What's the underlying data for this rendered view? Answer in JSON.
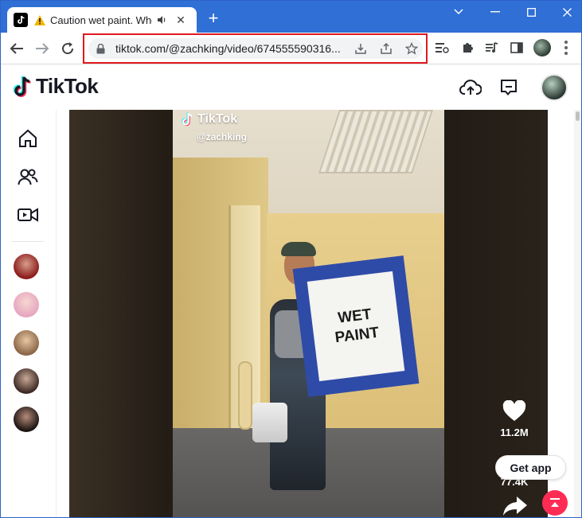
{
  "browser": {
    "tab": {
      "title": "Caution wet paint. Who w",
      "close_glyph": "✕"
    },
    "new_tab_glyph": "+",
    "address": {
      "url": "tiktok.com/@zachking/video/674555590316..."
    },
    "window_controls": {
      "minimize": "—",
      "maximize": "☐",
      "close": "✕",
      "chevron": "⌄"
    },
    "highlight_color": "#e0191f",
    "frame_color": "#2f6fd6"
  },
  "tiktok": {
    "logo_text": "TikTok",
    "accent_color": "#fe2c55",
    "sidebar": {
      "nav": [
        {
          "icon": "home-icon"
        },
        {
          "icon": "following-icon"
        },
        {
          "icon": "live-icon"
        }
      ],
      "accounts_count_shown": 5
    },
    "video": {
      "watermark_logo": "TikTok",
      "watermark_handle": "@zachking",
      "sign_line1": "WET",
      "sign_line2": "PAINT"
    },
    "actions": {
      "like_count": "11.2M",
      "comment_count": "77.4K"
    },
    "get_app_label": "Get app"
  }
}
